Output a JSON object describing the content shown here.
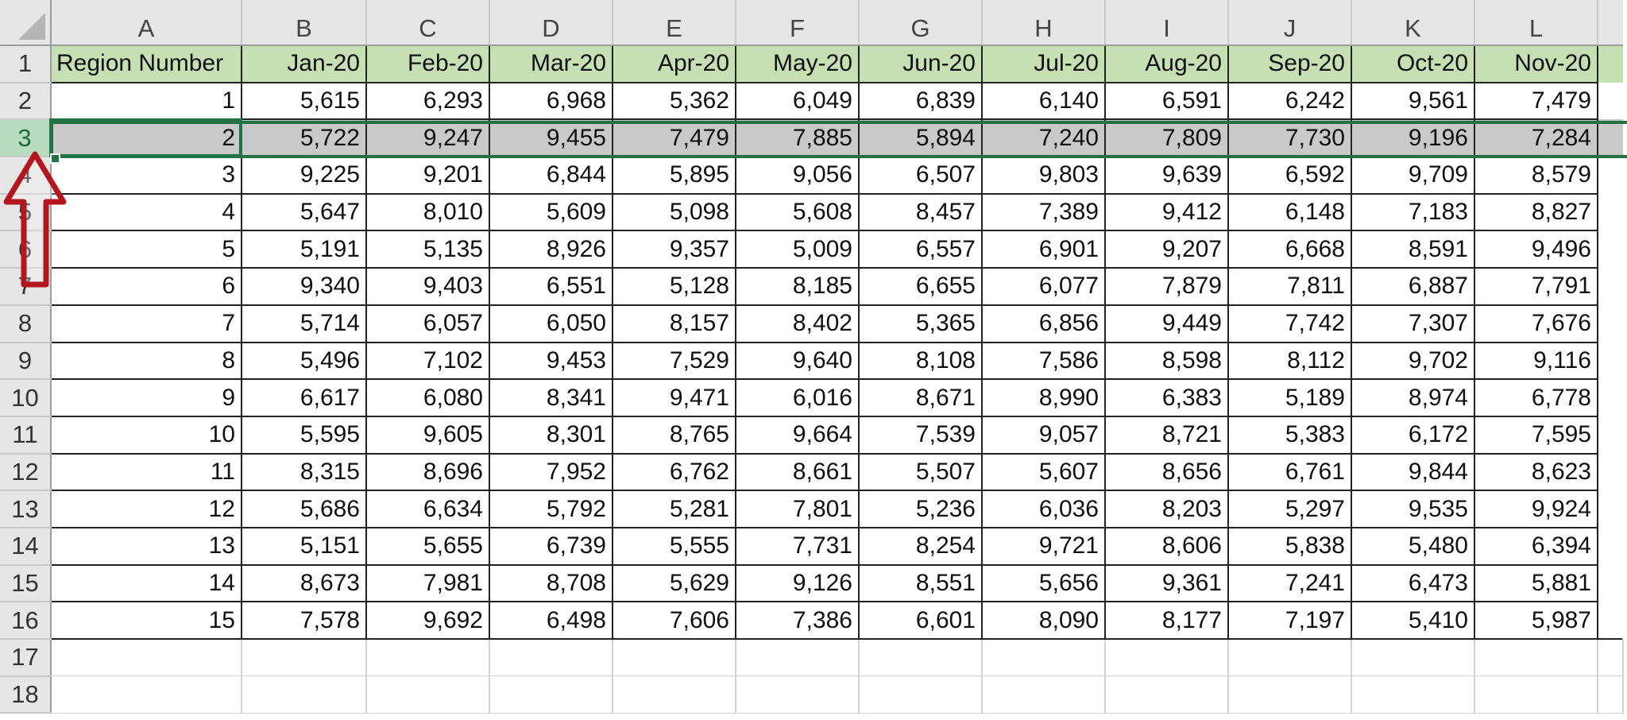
{
  "sheet": {
    "columns": [
      "A",
      "B",
      "C",
      "D",
      "E",
      "F",
      "G",
      "H",
      "I",
      "J",
      "K",
      "L"
    ],
    "row_numbers": [
      "1",
      "2",
      "3",
      "4",
      "5",
      "6",
      "7",
      "8",
      "9",
      "10",
      "11",
      "12",
      "13",
      "14",
      "15",
      "16",
      "17",
      "18"
    ],
    "selected_row": "3",
    "header_row": [
      "Region Number",
      "Jan-20",
      "Feb-20",
      "Mar-20",
      "Apr-20",
      "May-20",
      "Jun-20",
      "Jul-20",
      "Aug-20",
      "Sep-20",
      "Oct-20",
      "Nov-20"
    ],
    "rows": [
      [
        "1",
        "5,615",
        "6,293",
        "6,968",
        "5,362",
        "6,049",
        "6,839",
        "6,140",
        "6,591",
        "6,242",
        "9,561",
        "7,479"
      ],
      [
        "2",
        "5,722",
        "9,247",
        "9,455",
        "7,479",
        "7,885",
        "5,894",
        "7,240",
        "7,809",
        "7,730",
        "9,196",
        "7,284"
      ],
      [
        "3",
        "9,225",
        "9,201",
        "6,844",
        "5,895",
        "9,056",
        "6,507",
        "9,803",
        "9,639",
        "6,592",
        "9,709",
        "8,579"
      ],
      [
        "4",
        "5,647",
        "8,010",
        "5,609",
        "5,098",
        "5,608",
        "8,457",
        "7,389",
        "9,412",
        "6,148",
        "7,183",
        "8,827"
      ],
      [
        "5",
        "5,191",
        "5,135",
        "8,926",
        "9,357",
        "5,009",
        "6,557",
        "6,901",
        "9,207",
        "6,668",
        "8,591",
        "9,496"
      ],
      [
        "6",
        "9,340",
        "9,403",
        "6,551",
        "5,128",
        "8,185",
        "6,655",
        "6,077",
        "7,879",
        "7,811",
        "6,887",
        "7,791"
      ],
      [
        "7",
        "5,714",
        "6,057",
        "6,050",
        "8,157",
        "8,402",
        "5,365",
        "6,856",
        "9,449",
        "7,742",
        "7,307",
        "7,676"
      ],
      [
        "8",
        "5,496",
        "7,102",
        "9,453",
        "7,529",
        "9,640",
        "8,108",
        "7,586",
        "8,598",
        "8,112",
        "9,702",
        "9,116"
      ],
      [
        "9",
        "6,617",
        "6,080",
        "8,341",
        "9,471",
        "6,016",
        "8,671",
        "8,990",
        "6,383",
        "5,189",
        "8,974",
        "6,778"
      ],
      [
        "10",
        "5,595",
        "9,605",
        "8,301",
        "8,765",
        "9,664",
        "7,539",
        "9,057",
        "8,721",
        "5,383",
        "6,172",
        "7,595"
      ],
      [
        "11",
        "8,315",
        "8,696",
        "7,952",
        "6,762",
        "8,661",
        "5,507",
        "5,607",
        "8,656",
        "6,761",
        "9,844",
        "8,623"
      ],
      [
        "12",
        "5,686",
        "6,634",
        "5,792",
        "5,281",
        "7,801",
        "5,236",
        "6,036",
        "8,203",
        "5,297",
        "9,535",
        "9,924"
      ],
      [
        "13",
        "5,151",
        "5,655",
        "6,739",
        "5,555",
        "7,731",
        "8,254",
        "9,721",
        "8,606",
        "5,838",
        "5,480",
        "6,394"
      ],
      [
        "14",
        "8,673",
        "7,981",
        "8,708",
        "5,629",
        "9,126",
        "8,551",
        "5,656",
        "9,361",
        "7,241",
        "6,473",
        "5,881"
      ],
      [
        "15",
        "7,578",
        "9,692",
        "6,498",
        "7,606",
        "7,386",
        "6,601",
        "8,090",
        "8,177",
        "7,197",
        "5,410",
        "5,987"
      ]
    ]
  },
  "colors": {
    "header_fill": "#c6e0b4",
    "selected_row_fill": "#c9c9c9",
    "selection_green": "#217346",
    "annotation_arrow": "#b5161e"
  },
  "annotation": {
    "icon": "up-arrow-icon"
  }
}
